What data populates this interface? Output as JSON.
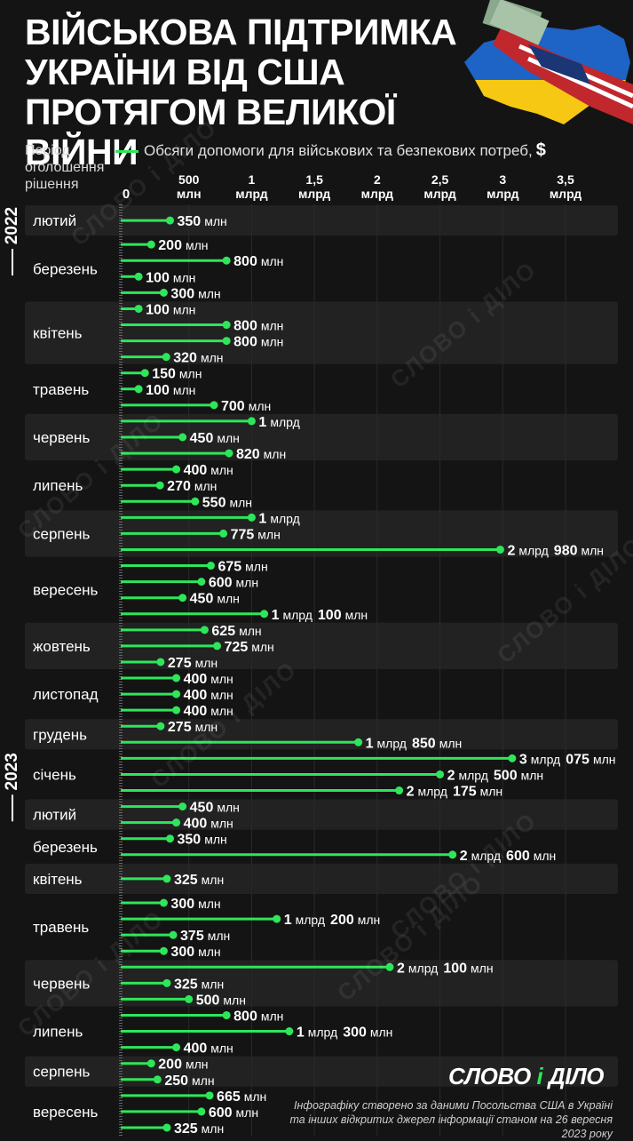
{
  "title": "Військова підтримка України від США протягом великої війни",
  "period_label": "Період оголошення рішення",
  "legend": {
    "label": "Обсяги допомоги для військових та безпекових потреб,",
    "currency": "$"
  },
  "watermark": "СЛОВО і ДІЛО",
  "logo": {
    "part1": "СЛОВО",
    "part2": "і",
    "part3": "ДІЛО"
  },
  "source": "Інфографіку створено за даними Посольства США в Україні та інших відкритих джерел інформації станом на 26 вересня 2023 року",
  "colors": {
    "background": "#141414",
    "band": "#222222",
    "bar": "#2ee65a"
  },
  "chart_data": {
    "type": "bar",
    "orientation": "horizontal",
    "unit": "млн $",
    "xlim": [
      0,
      3500
    ],
    "x_ticks": [
      {
        "value": 0,
        "l1": "0",
        "l2": ""
      },
      {
        "value": 500,
        "l1": "500",
        "l2": "млн"
      },
      {
        "value": 1000,
        "l1": "1",
        "l2": "млрд"
      },
      {
        "value": 1500,
        "l1": "1,5",
        "l2": "млрд"
      },
      {
        "value": 2000,
        "l1": "2",
        "l2": "млрд"
      },
      {
        "value": 2500,
        "l1": "2,5",
        "l2": "млрд"
      },
      {
        "value": 3000,
        "l1": "3",
        "l2": "млрд"
      },
      {
        "value": 3500,
        "l1": "3,5",
        "l2": "млрд"
      }
    ],
    "years": [
      "2022",
      "2023"
    ],
    "months": [
      {
        "name": "лютий",
        "year": "2022",
        "values": [
          {
            "value": 350,
            "num": "350",
            "unit": "млн"
          }
        ]
      },
      {
        "name": "березень",
        "year": "2022",
        "values": [
          {
            "value": 200,
            "num": "200",
            "unit": "млн"
          },
          {
            "value": 800,
            "num": "800",
            "unit": "млн"
          },
          {
            "value": 100,
            "num": "100",
            "unit": "млн"
          },
          {
            "value": 300,
            "num": "300",
            "unit": "млн"
          }
        ]
      },
      {
        "name": "квітень",
        "year": "2022",
        "values": [
          {
            "value": 100,
            "num": "100",
            "unit": "млн"
          },
          {
            "value": 800,
            "num": "800",
            "unit": "млн"
          },
          {
            "value": 800,
            "num": "800",
            "unit": "млн"
          },
          {
            "value": 320,
            "num": "320",
            "unit": "млн"
          }
        ]
      },
      {
        "name": "травень",
        "year": "2022",
        "values": [
          {
            "value": 150,
            "num": "150",
            "unit": "млн"
          },
          {
            "value": 100,
            "num": "100",
            "unit": "млн"
          },
          {
            "value": 700,
            "num": "700",
            "unit": "млн"
          }
        ]
      },
      {
        "name": "червень",
        "year": "2022",
        "values": [
          {
            "value": 1000,
            "num": "1",
            "unit": "млрд"
          },
          {
            "value": 450,
            "num": "450",
            "unit": "млн"
          },
          {
            "value": 820,
            "num": "820",
            "unit": "млн"
          }
        ]
      },
      {
        "name": "липень",
        "year": "2022",
        "values": [
          {
            "value": 400,
            "num": "400",
            "unit": "млн"
          },
          {
            "value": 270,
            "num": "270",
            "unit": "млн"
          },
          {
            "value": 550,
            "num": "550",
            "unit": "млн"
          }
        ]
      },
      {
        "name": "серпень",
        "year": "2022",
        "values": [
          {
            "value": 1000,
            "num": "1",
            "unit": "млрд"
          },
          {
            "value": 775,
            "num": "775",
            "unit": "млн"
          },
          {
            "value": 2980,
            "num": "2",
            "unit": "млрд",
            "num2": "980",
            "unit2": "млн"
          }
        ]
      },
      {
        "name": "вересень",
        "year": "2022",
        "values": [
          {
            "value": 675,
            "num": "675",
            "unit": "млн"
          },
          {
            "value": 600,
            "num": "600",
            "unit": "млн"
          },
          {
            "value": 450,
            "num": "450",
            "unit": "млн"
          },
          {
            "value": 1100,
            "num": "1",
            "unit": "млрд",
            "num2": "100",
            "unit2": "млн"
          }
        ]
      },
      {
        "name": "жовтень",
        "year": "2022",
        "values": [
          {
            "value": 625,
            "num": "625",
            "unit": "млн"
          },
          {
            "value": 725,
            "num": "725",
            "unit": "млн"
          },
          {
            "value": 275,
            "num": "275",
            "unit": "млн"
          }
        ]
      },
      {
        "name": "листопад",
        "year": "2022",
        "values": [
          {
            "value": 400,
            "num": "400",
            "unit": "млн"
          },
          {
            "value": 400,
            "num": "400",
            "unit": "млн"
          },
          {
            "value": 400,
            "num": "400",
            "unit": "млн"
          }
        ]
      },
      {
        "name": "грудень",
        "year": "2022",
        "values": [
          {
            "value": 275,
            "num": "275",
            "unit": "млн"
          },
          {
            "value": 1850,
            "num": "1",
            "unit": "млрд",
            "num2": "850",
            "unit2": "млн"
          }
        ]
      },
      {
        "name": "січень",
        "year": "2023",
        "values": [
          {
            "value": 3075,
            "num": "3",
            "unit": "млрд",
            "num2": "075",
            "unit2": "млн"
          },
          {
            "value": 2500,
            "num": "2",
            "unit": "млрд",
            "num2": "500",
            "unit2": "млн"
          },
          {
            "value": 2175,
            "num": "2",
            "unit": "млрд",
            "num2": "175",
            "unit2": "млн"
          }
        ]
      },
      {
        "name": "лютий",
        "year": "2023",
        "values": [
          {
            "value": 450,
            "num": "450",
            "unit": "млн"
          },
          {
            "value": 400,
            "num": "400",
            "unit": "млн"
          }
        ]
      },
      {
        "name": "березень",
        "year": "2023",
        "values": [
          {
            "value": 350,
            "num": "350",
            "unit": "млн"
          },
          {
            "value": 2600,
            "num": "2",
            "unit": "млрд",
            "num2": "600",
            "unit2": "млн"
          }
        ]
      },
      {
        "name": "квітень",
        "year": "2023",
        "values": [
          {
            "value": 325,
            "num": "325",
            "unit": "млн"
          }
        ]
      },
      {
        "name": "травень",
        "year": "2023",
        "values": [
          {
            "value": 300,
            "num": "300",
            "unit": "млн"
          },
          {
            "value": 1200,
            "num": "1",
            "unit": "млрд",
            "num2": "200",
            "unit2": "млн"
          },
          {
            "value": 375,
            "num": "375",
            "unit": "млн"
          },
          {
            "value": 300,
            "num": "300",
            "unit": "млн"
          }
        ]
      },
      {
        "name": "червень",
        "year": "2023",
        "values": [
          {
            "value": 2100,
            "num": "2",
            "unit": "млрд",
            "num2": "100",
            "unit2": "млн"
          },
          {
            "value": 325,
            "num": "325",
            "unit": "млн"
          },
          {
            "value": 500,
            "num": "500",
            "unit": "млн"
          }
        ]
      },
      {
        "name": "липень",
        "year": "2023",
        "values": [
          {
            "value": 800,
            "num": "800",
            "unit": "млн"
          },
          {
            "value": 1300,
            "num": "1",
            "unit": "млрд",
            "num2": "300",
            "unit2": "млн"
          },
          {
            "value": 400,
            "num": "400",
            "unit": "млн"
          }
        ]
      },
      {
        "name": "серпень",
        "year": "2023",
        "values": [
          {
            "value": 200,
            "num": "200",
            "unit": "млн"
          },
          {
            "value": 250,
            "num": "250",
            "unit": "млн"
          }
        ]
      },
      {
        "name": "вересень",
        "year": "2023",
        "values": [
          {
            "value": 665,
            "num": "665",
            "unit": "млн"
          },
          {
            "value": 600,
            "num": "600",
            "unit": "млн"
          },
          {
            "value": 325,
            "num": "325",
            "unit": "млн"
          }
        ]
      }
    ]
  }
}
